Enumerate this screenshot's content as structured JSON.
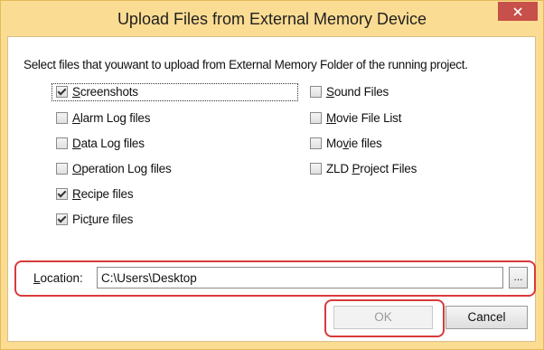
{
  "window": {
    "title": "Upload Files from External Memory Device",
    "close_glyph": "✕"
  },
  "instruction": "Select files that youwant to upload from External Memory Folder of the running project.",
  "checkboxes_left": [
    {
      "pre": "",
      "ul": "S",
      "post": "creenshots",
      "checked": true
    },
    {
      "pre": "",
      "ul": "A",
      "post": "larm Log files",
      "checked": false
    },
    {
      "pre": "",
      "ul": "D",
      "post": "ata Log files",
      "checked": false
    },
    {
      "pre": "",
      "ul": "O",
      "post": "peration Log files",
      "checked": false
    },
    {
      "pre": "",
      "ul": "R",
      "post": "ecipe files",
      "checked": true
    },
    {
      "pre": "Pic",
      "ul": "t",
      "post": "ure files",
      "checked": true
    }
  ],
  "checkboxes_right": [
    {
      "pre": "",
      "ul": "S",
      "post": "ound Files",
      "checked": false
    },
    {
      "pre": "",
      "ul": "M",
      "post": "ovie File List",
      "checked": false
    },
    {
      "pre": "Mo",
      "ul": "v",
      "post": "ie files",
      "checked": false
    },
    {
      "pre": "ZLD ",
      "ul": "P",
      "post": "roject Files",
      "checked": false
    }
  ],
  "location": {
    "label_ul": "L",
    "label_rest": "ocation:",
    "value": "C:\\Users\\Desktop",
    "browse_label": "..."
  },
  "buttons": {
    "ok": "OK",
    "cancel": "Cancel"
  },
  "colors": {
    "titlebar": "#fbdc93",
    "close": "#c7504a",
    "highlight": "#d93a3a"
  }
}
